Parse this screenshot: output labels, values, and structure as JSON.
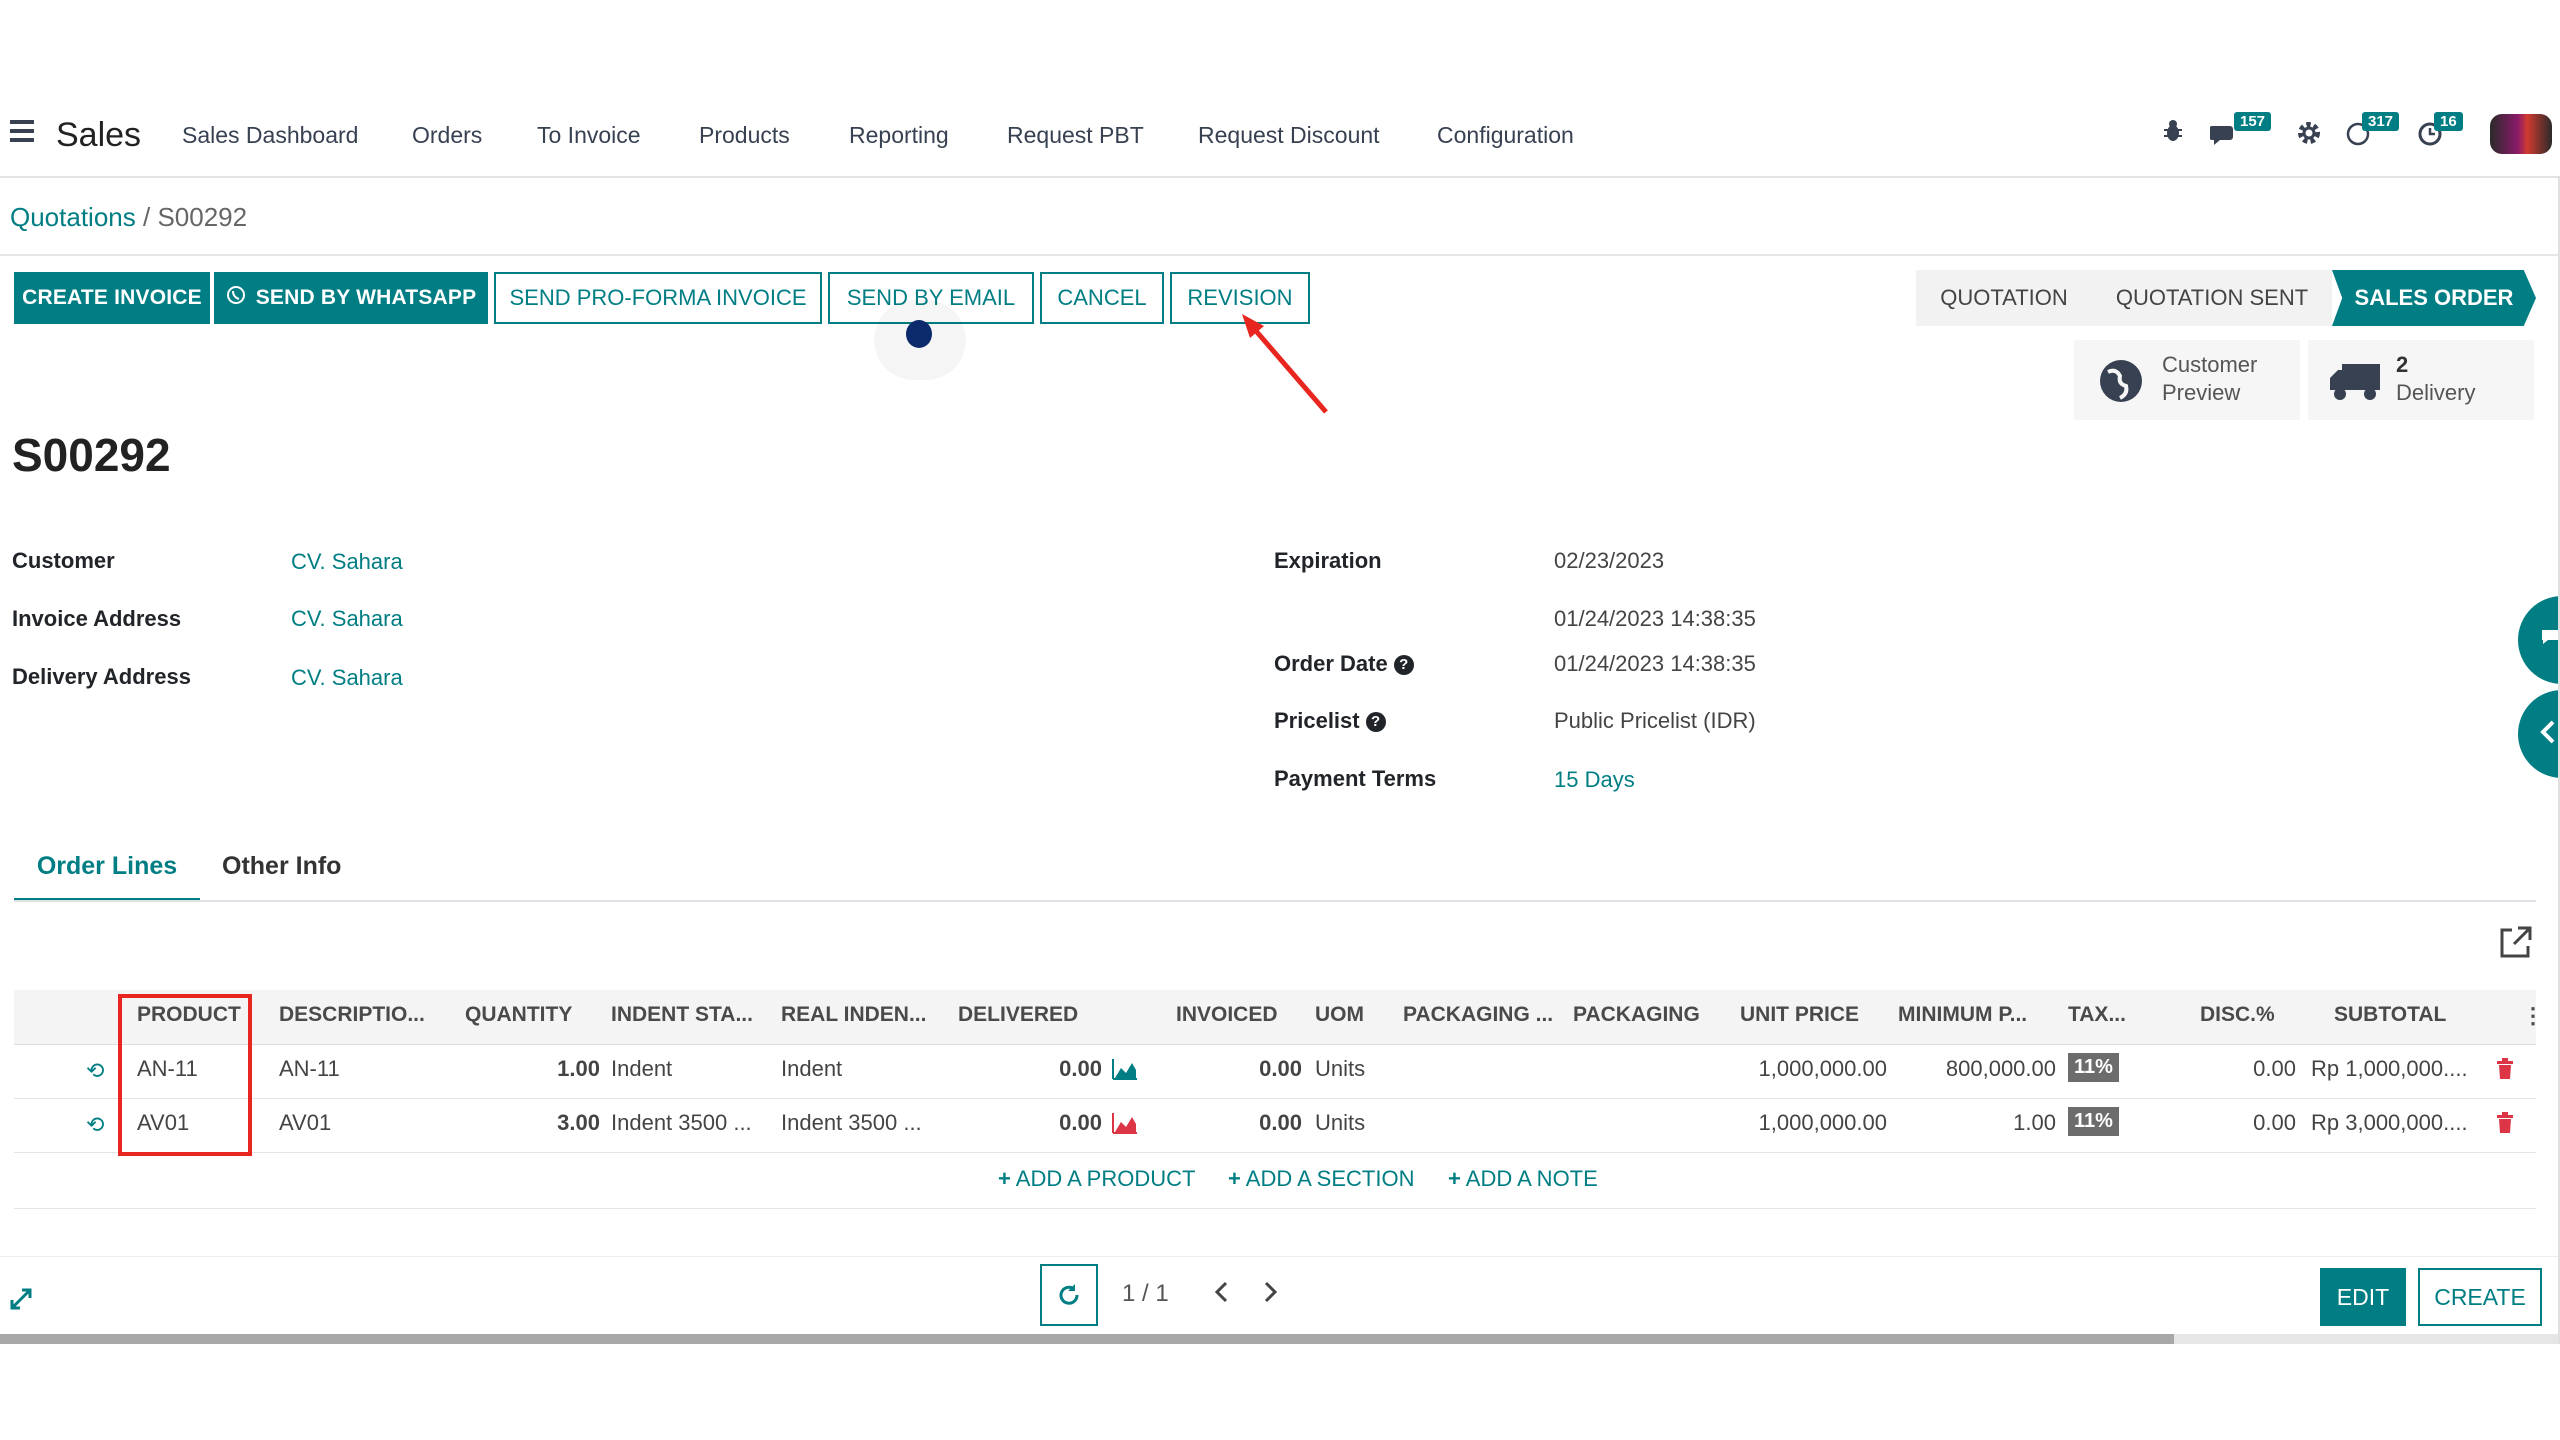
{
  "navbar": {
    "app_name": "Sales",
    "menu": [
      "Sales Dashboard",
      "Orders",
      "To Invoice",
      "Products",
      "Reporting",
      "Request PBT",
      "Request Discount",
      "Configuration"
    ],
    "badges": {
      "messages": "157",
      "activities": "317",
      "clock": "16"
    }
  },
  "breadcrumb": {
    "parent": "Quotations",
    "separator": "/",
    "current": "S00292"
  },
  "actions": {
    "create_invoice": "CREATE INVOICE",
    "send_whatsapp": "SEND BY WHATSAPP",
    "send_proforma": "SEND PRO-FORMA INVOICE",
    "send_email": "SEND BY EMAIL",
    "cancel": "CANCEL",
    "revision": "REVISION"
  },
  "statusbar": {
    "stages": [
      "QUOTATION",
      "QUOTATION SENT",
      "SALES ORDER"
    ],
    "active": "SALES ORDER"
  },
  "smart_buttons": {
    "customer_preview": [
      "Customer",
      "Preview"
    ],
    "delivery_count": "2",
    "delivery_label": "Delivery"
  },
  "record": {
    "name": "S00292",
    "customer_label": "Customer",
    "customer": "CV. Sahara",
    "invoice_address_label": "Invoice Address",
    "invoice_address": "CV. Sahara",
    "delivery_address_label": "Delivery Address",
    "delivery_address": "CV. Sahara",
    "expiration_label": "Expiration",
    "expiration": "02/23/2023",
    "extra_datetime": "01/24/2023 14:38:35",
    "order_date_label": "Order Date",
    "order_date": "01/24/2023 14:38:35",
    "pricelist_label": "Pricelist",
    "pricelist": "Public Pricelist (IDR)",
    "payment_terms_label": "Payment Terms",
    "payment_terms": "15 Days"
  },
  "tabs": {
    "order_lines": "Order Lines",
    "other_info": "Other Info"
  },
  "table": {
    "headers": {
      "product": "PRODUCT",
      "description": "DESCRIPTIO...",
      "quantity": "QUANTITY",
      "indent_status": "INDENT STA...",
      "real_indent": "REAL INDEN...",
      "delivered": "DELIVERED",
      "invoiced": "INVOICED",
      "uom": "UOM",
      "packaging_qty": "PACKAGING ...",
      "packaging": "PACKAGING",
      "unit_price": "UNIT PRICE",
      "minimum_price": "MINIMUM P...",
      "taxes": "TAX...",
      "discount": "DISC.%",
      "subtotal": "SUBTOTAL"
    },
    "rows": [
      {
        "product": "AN-11",
        "description": "AN-11",
        "quantity": "1.00",
        "indent_status": "Indent",
        "real_indent": "Indent",
        "delivered": "0.00",
        "invoiced": "0.00",
        "uom": "Units",
        "unit_price": "1,000,000.00",
        "minimum_price": "800,000.00",
        "tax": "11%",
        "discount": "0.00",
        "subtotal": "Rp 1,000,000...."
      },
      {
        "product": "AV01",
        "description": "AV01",
        "quantity": "3.00",
        "indent_status": "Indent 3500 ...",
        "real_indent": "Indent 3500 ...",
        "delivered": "0.00",
        "invoiced": "0.00",
        "uom": "Units",
        "unit_price": "1,000,000.00",
        "minimum_price": "1.00",
        "tax": "11%",
        "discount": "0.00",
        "subtotal": "Rp 3,000,000...."
      }
    ],
    "add_product": "ADD A PRODUCT",
    "add_section": "ADD A SECTION",
    "add_note": "ADD A NOTE"
  },
  "pager": {
    "value": "1 / 1"
  },
  "bottom_buttons": {
    "edit": "EDIT",
    "create": "CREATE"
  },
  "colors": {
    "accent": "#017e84",
    "annotation": "#e8261f",
    "danger": "#dc3545"
  }
}
